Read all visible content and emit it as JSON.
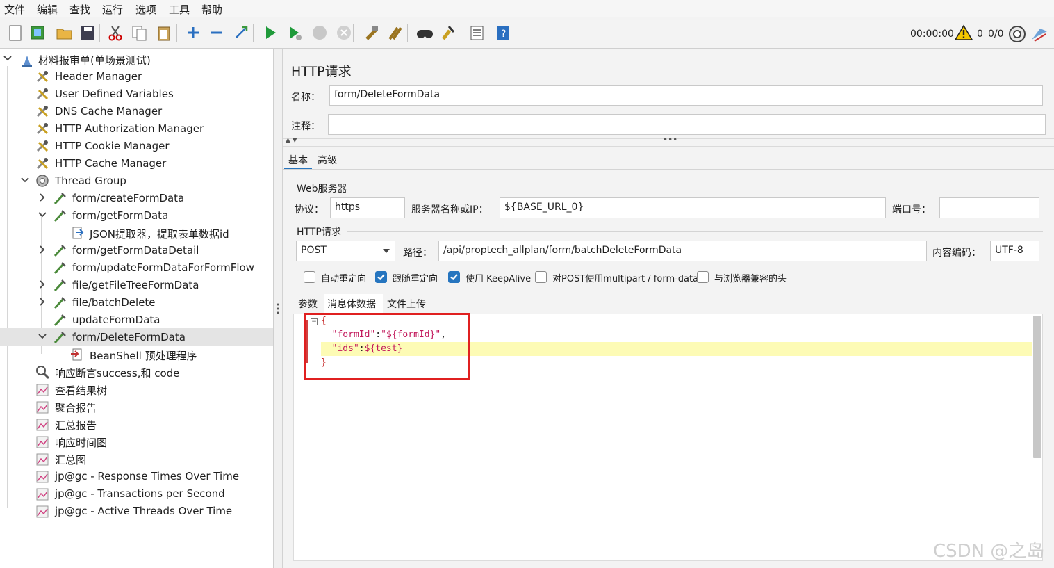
{
  "menu": [
    "文件",
    "编辑",
    "查找",
    "运行",
    "选项",
    "工具",
    "帮助"
  ],
  "toolbar": {
    "buttons": [
      "new-icon",
      "templates-icon",
      "open-icon",
      "save-icon",
      "cut-icon",
      "copy-icon",
      "paste-icon",
      "expand-icon",
      "collapse-icon",
      "toggle-icon",
      "start-icon",
      "start-no-pause-icon",
      "stop-icon",
      "shutdown-icon",
      "clear-icon",
      "clear-all-icon",
      "search-icon",
      "reset-search-icon",
      "function-helper-icon",
      "help-icon"
    ],
    "timer": "00:00:00",
    "warning_count": "0",
    "threads": "0/0"
  },
  "tree": [
    {
      "label": "材料报审单(单场景测试)",
      "icon": "test-plan-icon",
      "depth": 0,
      "chevron": "down"
    },
    {
      "label": "Header Manager",
      "icon": "config-element-icon",
      "depth": 1,
      "chevron": ""
    },
    {
      "label": "User Defined Variables",
      "icon": "config-element-icon",
      "depth": 1,
      "chevron": ""
    },
    {
      "label": "DNS Cache Manager",
      "icon": "config-element-icon",
      "depth": 1,
      "chevron": ""
    },
    {
      "label": "HTTP Authorization Manager",
      "icon": "config-element-icon",
      "depth": 1,
      "chevron": ""
    },
    {
      "label": "HTTP Cookie Manager",
      "icon": "config-element-icon",
      "depth": 1,
      "chevron": ""
    },
    {
      "label": "HTTP Cache Manager",
      "icon": "config-element-icon",
      "depth": 1,
      "chevron": ""
    },
    {
      "label": "Thread Group",
      "icon": "thread-group-icon",
      "depth": 1,
      "chevron": "down"
    },
    {
      "label": "form/createFormData",
      "icon": "sampler-icon",
      "depth": 2,
      "chevron": "right"
    },
    {
      "label": "form/getFormData",
      "icon": "sampler-icon",
      "depth": 2,
      "chevron": "down"
    },
    {
      "label": "JSON提取器，提取表单数据id",
      "icon": "post-processor-icon",
      "depth": 3,
      "chevron": ""
    },
    {
      "label": "form/getFormDataDetail",
      "icon": "sampler-icon",
      "depth": 2,
      "chevron": "right"
    },
    {
      "label": "form/updateFormDataForFormFlow",
      "icon": "sampler-icon",
      "depth": 2,
      "chevron": ""
    },
    {
      "label": "file/getFileTreeFormData",
      "icon": "sampler-icon",
      "depth": 2,
      "chevron": "right"
    },
    {
      "label": "file/batchDelete",
      "icon": "sampler-icon",
      "depth": 2,
      "chevron": "right"
    },
    {
      "label": "updateFormData",
      "icon": "sampler-icon",
      "depth": 2,
      "chevron": ""
    },
    {
      "label": "form/DeleteFormData",
      "icon": "sampler-icon",
      "depth": 2,
      "chevron": "down",
      "selected": true
    },
    {
      "label": "BeanShell 预处理程序",
      "icon": "pre-processor-icon",
      "depth": 3,
      "chevron": ""
    },
    {
      "label": "响应断言success,和 code",
      "icon": "assertion-icon",
      "depth": 1,
      "chevron": ""
    },
    {
      "label": "查看结果树",
      "icon": "listener-icon",
      "depth": 1,
      "chevron": ""
    },
    {
      "label": "聚合报告",
      "icon": "listener-icon",
      "depth": 1,
      "chevron": ""
    },
    {
      "label": "汇总报告",
      "icon": "listener-icon",
      "depth": 1,
      "chevron": ""
    },
    {
      "label": "响应时间图",
      "icon": "listener-icon",
      "depth": 1,
      "chevron": ""
    },
    {
      "label": "汇总图",
      "icon": "listener-icon",
      "depth": 1,
      "chevron": ""
    },
    {
      "label": "jp@gc - Response Times Over Time",
      "icon": "listener-icon",
      "depth": 1,
      "chevron": ""
    },
    {
      "label": "jp@gc - Transactions per Second",
      "icon": "listener-icon",
      "depth": 1,
      "chevron": ""
    },
    {
      "label": "jp@gc - Active Threads Over Time",
      "icon": "listener-icon",
      "depth": 1,
      "chevron": ""
    }
  ],
  "panel": {
    "title": "HTTP请求",
    "name_label": "名称：",
    "name_value": "form/DeleteFormData",
    "comment_label": "注释：",
    "comment_value": "",
    "tabs": [
      "基本",
      "高级"
    ],
    "web_server_legend": "Web服务器",
    "protocol_label": "协议：",
    "protocol_value": "https",
    "server_label": "服务器名称或IP：",
    "server_value": "${BASE_URL_0}",
    "port_label": "端口号：",
    "port_value": "",
    "http_request_legend": "HTTP请求",
    "method_value": "POST",
    "path_label": "路径：",
    "path_value": "/api/proptech_allplan/form/batchDeleteFormData",
    "encoding_label": "内容编码：",
    "encoding_value": "UTF-8",
    "checkboxes": [
      {
        "label": "自动重定向",
        "checked": false
      },
      {
        "label": "跟随重定向",
        "checked": true
      },
      {
        "label": "使用 KeepAlive",
        "checked": true
      },
      {
        "label": "对POST使用multipart / form-data",
        "checked": false
      },
      {
        "label": "与浏览器兼容的头",
        "checked": false
      }
    ],
    "sub_tabs": [
      "参数",
      "消息体数据",
      "文件上传"
    ],
    "body_lines": [
      "{",
      "  \"formId\":\"${formId}\",",
      "  \"ids\":${test}",
      "}"
    ]
  },
  "watermark": "CSDN @之岛"
}
